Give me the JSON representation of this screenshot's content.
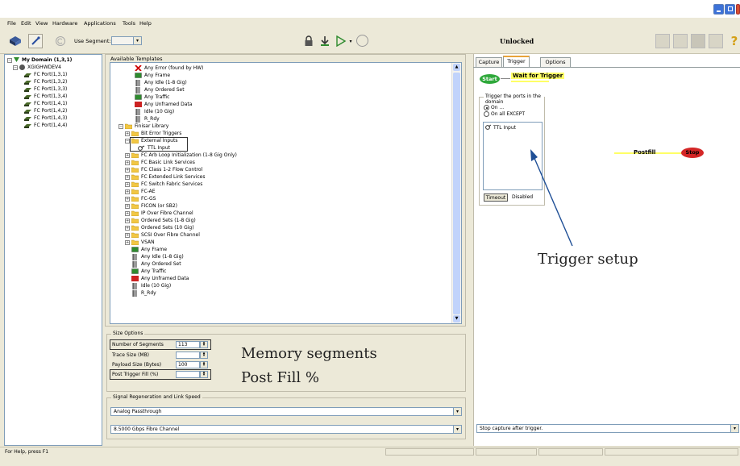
{
  "menu": [
    "File",
    "Edit",
    "View",
    "Hardware",
    "Applications",
    "Tools",
    "Help"
  ],
  "toolbar": {
    "use_segment_label": "Use Segment:",
    "use_segment_value": "",
    "status_label": "Unlocked"
  },
  "domain_tree": {
    "root": "My Domain (1,3,1)",
    "device": "XGIGHWDEV4",
    "ports": [
      "FC Port(1,3,1)",
      "FC Port(1,3,2)",
      "FC Port(1,3,3)",
      "FC Port(1,3,4)",
      "FC Port(1,4,1)",
      "FC Port(1,4,2)",
      "FC Port(1,4,3)",
      "FC Port(1,4,4)"
    ]
  },
  "templates": {
    "title": "Available Templates",
    "top_items": [
      {
        "label": "Any Error (found by HW)",
        "icon": "error-x-icon",
        "color": "#cc0000"
      },
      {
        "label": "Any Frame",
        "icon": "frame-icon",
        "color": "#2e8b2e"
      },
      {
        "label": "Any Idle (1-8 Gig)",
        "icon": "ordered-set-icon",
        "color": "#333333"
      },
      {
        "label": "Any Ordered Set",
        "icon": "ordered-set-icon",
        "color": "#333333"
      },
      {
        "label": "Any Traffic",
        "icon": "frame-icon",
        "color": "#2e8b2e"
      },
      {
        "label": "Any Unframed Data",
        "icon": "unframed-icon",
        "color": "#cc2222"
      },
      {
        "label": "Idle (10 Gig)",
        "icon": "ordered-set-icon",
        "color": "#333333"
      },
      {
        "label": "R_Rdy",
        "icon": "ordered-set-icon",
        "color": "#333333"
      }
    ],
    "finisar_library": "Finisar Library",
    "bit_error_triggers": "Bit Error Triggers",
    "external_inputs": "External Inputs",
    "ttl_input": "TTL Input",
    "folders": [
      "FC Arb Loop Initialization (1-8 Gig Only)",
      "FC Basic Link Services",
      "FC Class 1-2 Flow Control",
      "FC Extended Link Services",
      "FC Switch Fabric Services",
      "FC-AE",
      "FC-GS",
      "FICON (or SB2)",
      "IP Over Fibre Channel",
      "Ordered Sets (1-8 Gig)",
      "Ordered Sets (10 Gig)",
      "SCSI Over Fibre Channel",
      "VSAN"
    ],
    "bottom_items": [
      {
        "label": "Any Frame",
        "icon": "frame-icon",
        "color": "#2e8b2e"
      },
      {
        "label": "Any Idle (1-8 Gig)",
        "icon": "ordered-set-icon",
        "color": "#333333"
      },
      {
        "label": "Any Ordered Set",
        "icon": "ordered-set-icon",
        "color": "#333333"
      },
      {
        "label": "Any Traffic",
        "icon": "frame-icon",
        "color": "#2e8b2e"
      },
      {
        "label": "Any Unframed Data",
        "icon": "unframed-icon",
        "color": "#cc2222"
      },
      {
        "label": "Idle (10 Gig)",
        "icon": "ordered-set-icon",
        "color": "#333333"
      },
      {
        "label": "R_Rdy",
        "icon": "ordered-set-icon",
        "color": "#333333"
      }
    ]
  },
  "size_options": {
    "title": "Size Options",
    "num_segments_label": "Number of Segments",
    "num_segments_value": "113",
    "trace_size_label": "Trace Size (MB)",
    "trace_size_value": "",
    "payload_label": "Payload Size (Bytes)",
    "payload_value": "100",
    "post_fill_label": "Post Trigger Fill (%)",
    "post_fill_value": ""
  },
  "signal": {
    "title": "Signal Regeneration and Link Speed",
    "regen_value": "Analog Passthrough",
    "speed_value": "8.5000 Gbps Fibre Channel"
  },
  "tabs": [
    "Capture",
    "Trigger",
    "Options"
  ],
  "trigger": {
    "start": "Start",
    "wait": "Wait for Trigger",
    "ports_group_title": "Trigger the ports in the domain",
    "radio_on": "On ...",
    "radio_all_except": "On all EXCEPT",
    "list_item": "TTL Input",
    "timeout_button": "Timeout",
    "timeout_status": "Disabled",
    "postfill": "Postfill",
    "stop": "Stop",
    "stop_option": "Stop capture after trigger."
  },
  "annotations": {
    "trigger_setup": "Trigger setup",
    "memory_segments": "Memory segments",
    "post_fill": "Post Fill %"
  },
  "status_text": "For Help, press F1",
  "colors": {
    "start_green": "#2ea83a",
    "stop_red": "#d42626",
    "highlight_yellow": "#ffff66",
    "arrow_blue": "#1f4f96"
  }
}
